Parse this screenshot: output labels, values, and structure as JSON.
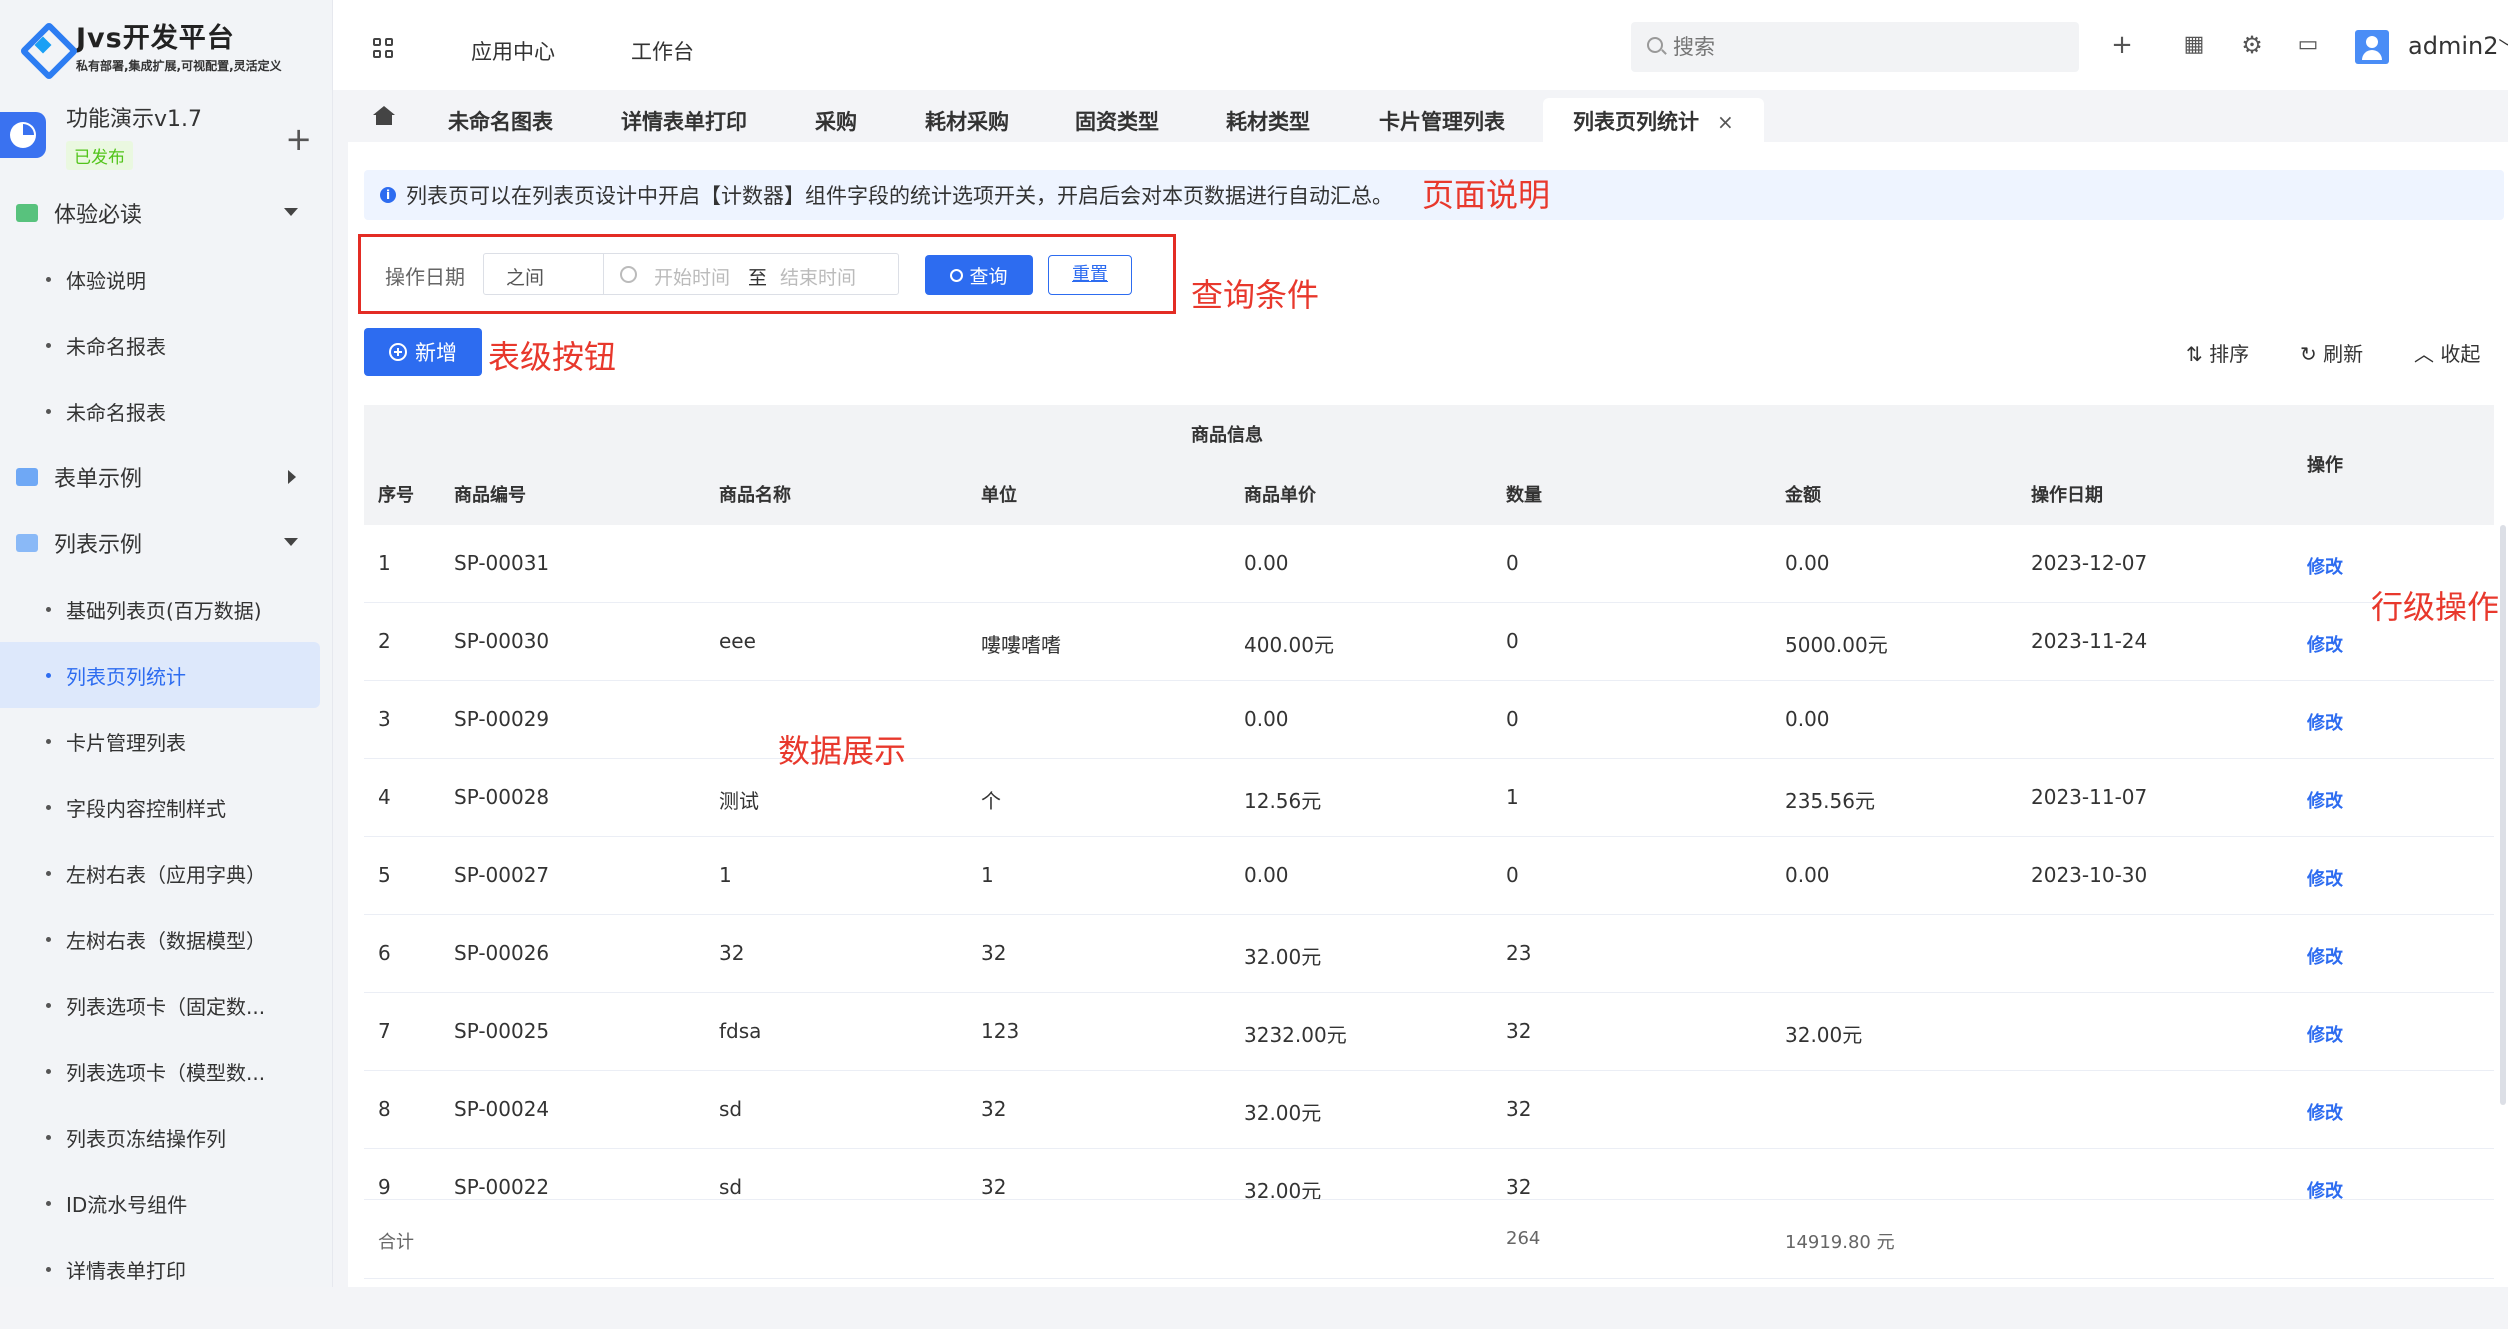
{
  "logo": {
    "title": "Jvs开发平台",
    "subtitle": "私有部署,集成扩展,可视配置,灵活定义"
  },
  "app": {
    "name": "功能演示v1.7",
    "badge": "已发布"
  },
  "sidebar": {
    "groups": [
      {
        "label": "体验必读",
        "items": [
          "体验说明",
          "未命名报表",
          "未命名报表"
        ]
      },
      {
        "label": "表单示例",
        "items": []
      },
      {
        "label": "列表示例",
        "items": [
          "基础列表页(百万数据)",
          "列表页列统计",
          "卡片管理列表",
          "字段内容控制样式",
          "左树右表（应用字典）",
          "左树右表（数据模型）",
          "列表选项卡（固定数...",
          "列表选项卡（模型数...",
          "列表页冻结操作列",
          "ID流水号组件",
          "详情表单打印"
        ]
      }
    ]
  },
  "topbar": {
    "nav": [
      "应用中心",
      "工作台"
    ],
    "search_placeholder": "搜索",
    "username": "admin2",
    "icons": [
      "plus-icon",
      "apps-icon",
      "gear-icon",
      "message-icon"
    ]
  },
  "tabs": [
    "未命名图表",
    "详情表单打印",
    "采购",
    "耗材采购",
    "固资类型",
    "耗材类型",
    "卡片管理列表",
    "列表页列统计"
  ],
  "active_tab_close": "×",
  "notice": "列表页可以在列表页设计中开启【计数器】组件字段的统计选项开关，开启后会对本页数据进行自动汇总。",
  "annotations": {
    "page_desc": "页面说明",
    "query": "查询条件",
    "table_buttons": "表级按钮",
    "row_ops": "行级操作",
    "data_display": "数据展示"
  },
  "query": {
    "label": "操作日期",
    "mode": "之间",
    "start_placeholder": "开始时间",
    "to": "至",
    "end_placeholder": "结束时间",
    "search_btn": "查询",
    "reset_btn": "重置"
  },
  "toolbar": {
    "add": "新增",
    "sort": "排序",
    "refresh": "刷新",
    "collapse": "收起"
  },
  "table": {
    "group_header": "商品信息",
    "headers": [
      "序号",
      "商品编号",
      "商品名称",
      "单位",
      "商品单价",
      "数量",
      "金额",
      "操作日期",
      "操作"
    ],
    "edit_label": "修改",
    "rows": [
      [
        "1",
        "SP-00031",
        "",
        "",
        "0.00",
        "0",
        "0.00",
        "2023-12-07"
      ],
      [
        "2",
        "SP-00030",
        "eee",
        "嘍嘍嗜嗜",
        "400.00元",
        "0",
        "5000.00元",
        "2023-11-24"
      ],
      [
        "3",
        "SP-00029",
        "",
        "",
        "0.00",
        "0",
        "0.00",
        ""
      ],
      [
        "4",
        "SP-00028",
        "测试",
        "个",
        "12.56元",
        "1",
        "235.56元",
        "2023-11-07"
      ],
      [
        "5",
        "SP-00027",
        "1",
        "1",
        "0.00",
        "0",
        "0.00",
        "2023-10-30"
      ],
      [
        "6",
        "SP-00026",
        "32",
        "32",
        "32.00元",
        "23",
        "",
        ""
      ],
      [
        "7",
        "SP-00025",
        "fdsa",
        "123",
        "3232.00元",
        "32",
        "32.00元",
        ""
      ],
      [
        "8",
        "SP-00024",
        "sd",
        "32",
        "32.00元",
        "32",
        "",
        ""
      ],
      [
        "9",
        "SP-00022",
        "sd",
        "32",
        "32.00元",
        "32",
        "",
        ""
      ]
    ],
    "total": {
      "label": "合计",
      "quantity": "264",
      "amount": "14919.80 元"
    }
  }
}
